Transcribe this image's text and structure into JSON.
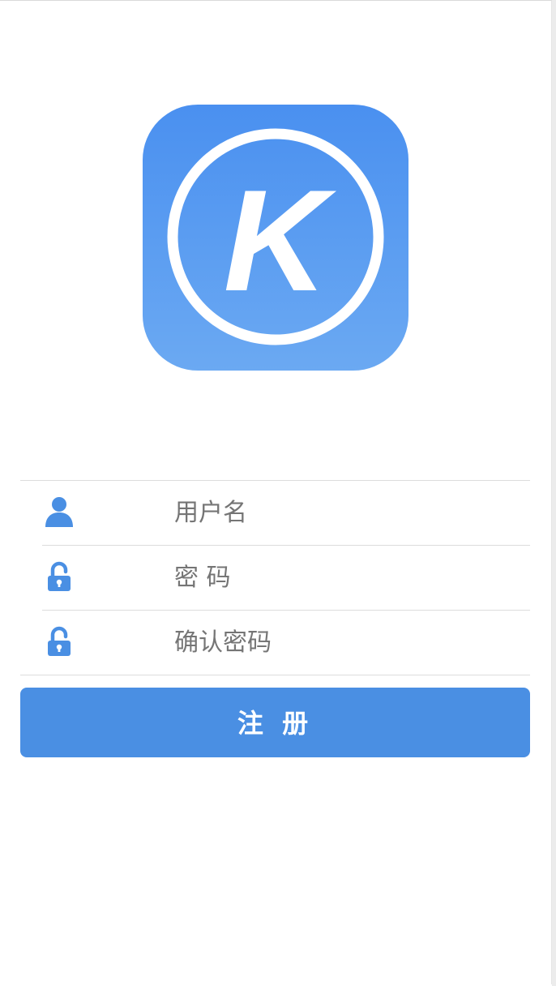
{
  "logo": {
    "letter": "K",
    "color_top": "#4a90f0",
    "color_bottom": "#6ba9f2"
  },
  "form": {
    "username": {
      "placeholder": "用户名",
      "icon": "user-icon"
    },
    "password": {
      "placeholder": "密 码",
      "icon": "unlock-icon"
    },
    "confirm_password": {
      "placeholder": "确认密码",
      "icon": "unlock-icon"
    }
  },
  "register_button": {
    "label": "注 册"
  },
  "colors": {
    "accent": "#4a8fe3",
    "icon": "#4a8fe3",
    "placeholder": "#b6b6b6",
    "divider": "#dcdcdc"
  }
}
